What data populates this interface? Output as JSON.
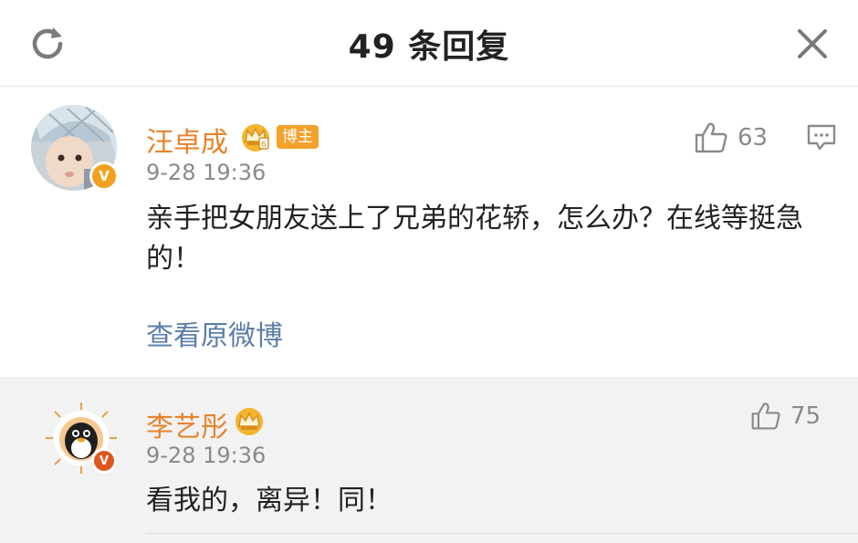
{
  "header": {
    "title": "49 条回复",
    "refresh_icon": "refresh-icon",
    "close_icon": "close-icon"
  },
  "main_comment": {
    "username": "汪卓成",
    "badge_label": "博主",
    "time": "9-28 19:36",
    "content": "亲手把女朋友送上了兄弟的花轿，怎么办？在线等挺急的！",
    "likes": "63",
    "view_original": "查看原微博"
  },
  "reply": {
    "username": "李艺彤",
    "time": "9-28 19:36",
    "content": "看我的，离异！同！",
    "likes": "75"
  },
  "colors": {
    "username": "#e8832b",
    "link": "#5b7ea8",
    "verified_badge": "#f0a21f",
    "reply_bg": "#f2f2f2"
  }
}
